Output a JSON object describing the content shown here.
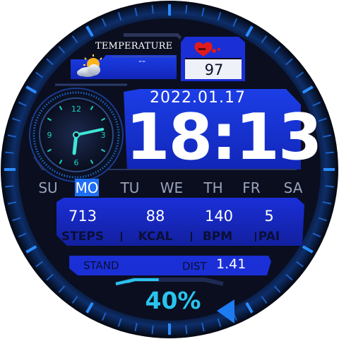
{
  "weather": {
    "label": "TEMPERATURE",
    "value": "--",
    "icon": "partly-cloudy-icon"
  },
  "heart_rate": {
    "value": "97",
    "icon": "heart-icon"
  },
  "date": "2022.01.17",
  "time": "18:13",
  "analog_clock": {
    "numerals": [
      "12",
      "3",
      "6",
      "9"
    ],
    "hour": 18,
    "minute": 13
  },
  "weekdays": {
    "days": [
      "SU",
      "MO",
      "TU",
      "WE",
      "TH",
      "FR",
      "SA"
    ],
    "active": "MO"
  },
  "stats": [
    {
      "value": "713",
      "label": "STEPS"
    },
    {
      "value": "88",
      "label": "KCAL"
    },
    {
      "value": "140",
      "label": "BPM"
    },
    {
      "value": "5",
      "label": "PAI"
    }
  ],
  "activity": {
    "stand_label": "STAND",
    "dist_label": "DIST",
    "dist_value": "1.41"
  },
  "battery": {
    "value": "40%",
    "level": 0.4
  },
  "colors": {
    "accent": "#1d7cf2",
    "panel": "#1a2fd6",
    "cyan": "#29c4ef",
    "background": "#0a0e20"
  }
}
